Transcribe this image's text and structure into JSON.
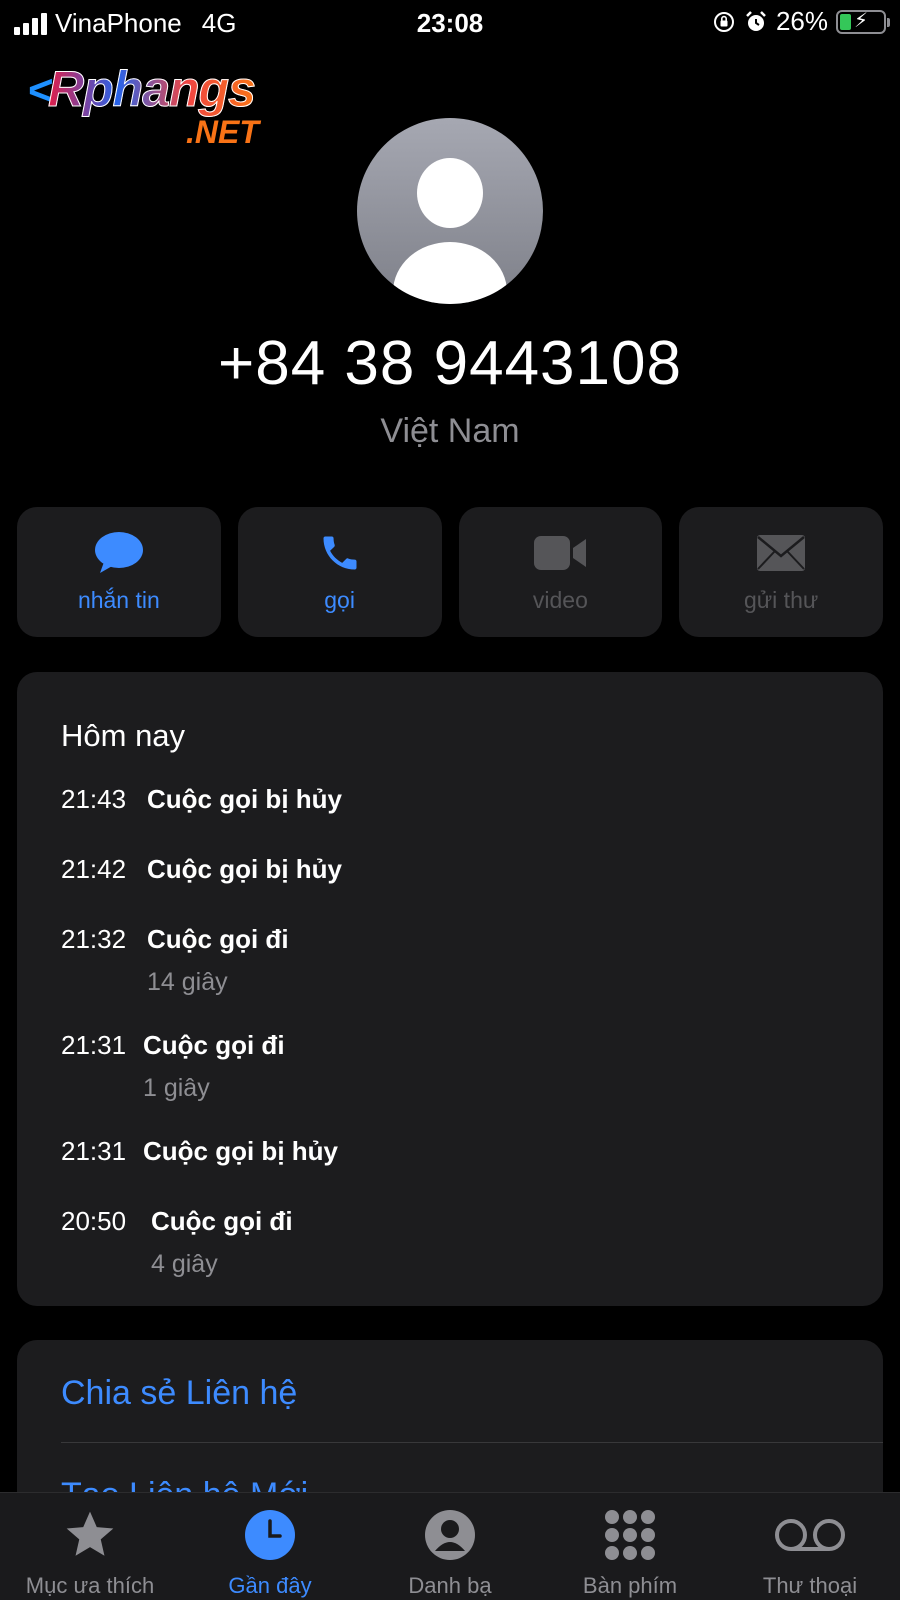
{
  "status_bar": {
    "carrier": "VinaPhone",
    "network": "4G",
    "time": "23:08",
    "battery_percent": "26%",
    "battery_level": 0.26,
    "icons": [
      "signal-icon",
      "orientation-lock-icon",
      "alarm-icon",
      "battery-charging-icon"
    ]
  },
  "watermark": {
    "main": "Rphangs",
    "suffix": ".NET"
  },
  "contact": {
    "number": "+84 38 9443108",
    "subtitle": "Việt Nam"
  },
  "actions": [
    {
      "label": "nhắn tin",
      "icon": "message-icon",
      "enabled": true
    },
    {
      "label": "gọi",
      "icon": "phone-icon",
      "enabled": true
    },
    {
      "label": "video",
      "icon": "video-icon",
      "enabled": false
    },
    {
      "label": "gửi thư",
      "icon": "mail-icon",
      "enabled": false
    }
  ],
  "recents": {
    "title": "Hôm nay",
    "calls": [
      {
        "time": "21:43",
        "type": "Cuộc gọi bị hủy",
        "duration": ""
      },
      {
        "time": "21:42",
        "type": "Cuộc gọi bị hủy",
        "duration": ""
      },
      {
        "time": "21:32",
        "type": "Cuộc gọi đi",
        "duration": "14 giây"
      },
      {
        "time": "21:31",
        "type": "Cuộc gọi đi",
        "duration": "1 giây"
      },
      {
        "time": "21:31",
        "type": "Cuộc gọi bị hủy",
        "duration": ""
      },
      {
        "time": "20:50",
        "type": "Cuộc gọi đi",
        "duration": "4 giây"
      }
    ]
  },
  "options": {
    "share_contact": "Chia sẻ Liên hệ",
    "create_contact": "Tạo Liên hệ Mới"
  },
  "tabbar": {
    "tabs": [
      {
        "label": "Mục ưa thích",
        "icon": "star-icon",
        "active": false
      },
      {
        "label": "Gần đây",
        "icon": "clock-icon",
        "active": true
      },
      {
        "label": "Danh bạ",
        "icon": "person-circle-icon",
        "active": false
      },
      {
        "label": "Bàn phím",
        "icon": "keypad-icon",
        "active": false
      },
      {
        "label": "Thư thoại",
        "icon": "voicemail-icon",
        "active": false
      }
    ]
  },
  "colors": {
    "accent": "#3d8bff",
    "card": "#1c1c1e",
    "secondary_text": "#8e8e93",
    "battery_green": "#34c759"
  }
}
